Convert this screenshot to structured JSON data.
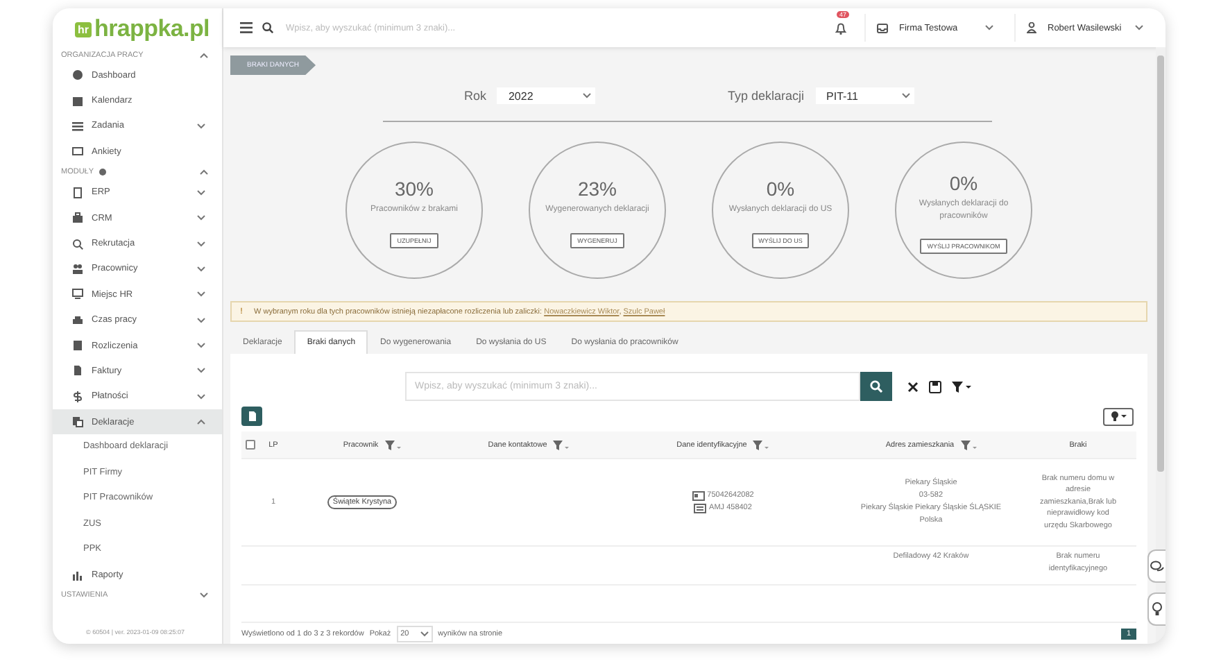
{
  "logo": {
    "badge": "hr",
    "text": "hrappka.pl"
  },
  "sidebar": {
    "sections": [
      {
        "title": "ORGANIZACJA PRACY",
        "expanded": true,
        "items": [
          {
            "label": "Dashboard",
            "selected": false
          },
          {
            "label": "Kalendarz",
            "selected": false
          },
          {
            "label": "Zadania",
            "expanded": false,
            "selected": false
          },
          {
            "label": "Ankiety",
            "selected": false
          }
        ]
      },
      {
        "title": "MODUŁY",
        "expanded": true,
        "items": [
          {
            "label": "ERP",
            "expanded": false,
            "selected": false
          },
          {
            "label": "CRM",
            "expanded": false,
            "selected": false
          },
          {
            "label": "Rekrutacja",
            "expanded": false,
            "selected": false
          },
          {
            "label": "Pracownicy",
            "expanded": false,
            "selected": false
          },
          {
            "label": "Miejsc HR",
            "expanded": false,
            "selected": false
          },
          {
            "label": "Czas pracy",
            "expanded": false,
            "selected": false
          },
          {
            "label": "Rozliczenia",
            "expanded": false,
            "selected": false
          },
          {
            "label": "Faktury",
            "expanded": false,
            "selected": false
          },
          {
            "label": "Płatności",
            "expanded": false,
            "selected": false
          },
          {
            "label": "Deklaracje",
            "expanded": true,
            "selected": true,
            "children": [
              {
                "label": "Dashboard deklaracji"
              },
              {
                "label": "PIT Firmy"
              },
              {
                "label": "PIT Pracowników"
              },
              {
                "label": "ZUS"
              },
              {
                "label": "PPK"
              }
            ]
          },
          {
            "label": "Raporty",
            "selected": false
          }
        ]
      },
      {
        "title": "USTAWIENIA",
        "expanded": false
      }
    ],
    "footer": "© 60504 | ver. 2023-01-09 08:25:07"
  },
  "topbar": {
    "search_placeholder": "Wpisz, aby wyszukać (minimum 3 znaki)...",
    "notifications": "47",
    "company": "Firma Testowa",
    "user": "Robert Wasilewski"
  },
  "breadcrumb": "BRAKI DANYCH",
  "filters": [
    {
      "label": "Rok",
      "value": "2022"
    },
    {
      "label": "Typ deklaracji",
      "value": "PIT-11"
    }
  ],
  "stats": [
    {
      "percent": "30%",
      "label": "Pracowników z brakami",
      "button": "UZUPEŁNIJ"
    },
    {
      "percent": "23%",
      "label": "Wygenerowanych deklaracji",
      "button": "WYGENERUJ"
    },
    {
      "percent": "0%",
      "label": "Wysłanych deklaracji do US",
      "button": "WYŚLIJ DO US"
    },
    {
      "percent": "0%",
      "label": "Wysłanych deklaracji do pracowników",
      "button": "WYŚLIJ PRACOWNIKOM"
    }
  ],
  "alert": {
    "icon": "!",
    "text": "W wybranym roku dla tych pracowników istnieją niezapłacone rozliczenia lub zaliczki:",
    "links": [
      "Nowaczkiewicz Wiktor",
      "Szulc Paweł"
    ],
    "separator": ","
  },
  "tabs": [
    {
      "label": "Deklaracje",
      "selected": false
    },
    {
      "label": "Braki danych",
      "selected": true
    },
    {
      "label": "Do wygenerowania",
      "selected": false
    },
    {
      "label": "Do wysłania do US",
      "selected": false
    },
    {
      "label": "Do wysłania do pracowników",
      "selected": false
    }
  ],
  "search": {
    "placeholder": "Wpisz, aby wyszukać (minimum 3 znaki)..."
  },
  "table": {
    "select_all": {
      "checked": false
    },
    "columns": [
      {
        "label": "LP",
        "filter": false
      },
      {
        "label": "Pracownik",
        "filter": true
      },
      {
        "label": "Dane kontaktowe",
        "filter": true
      },
      {
        "label": "Dane identyfikacyjne",
        "filter": true
      },
      {
        "label": "Adres zamieszkania",
        "filter": true
      },
      {
        "label": "Braki",
        "filter": false
      }
    ],
    "rows": [
      {
        "lp": "1",
        "employee": "Świątek Krystyna",
        "ids": [
          "75042642082",
          "AMJ 458402"
        ],
        "address": [
          "Piekary Śląskie",
          "03-582",
          "Piekary Śląskie Piekary Śląskie ŚLĄSKIE",
          "Polska"
        ],
        "missing": "Brak numeru domu w adresie zamieszkania,Brak lub nieprawidłowy kod urzędu Skarbowego"
      },
      {
        "address": [
          "Defiladowy 42 Kraków"
        ],
        "missing": "Brak numeru identyfikacyjnego"
      }
    ]
  },
  "pager": {
    "summary": "Wyświetlono od 1 do 3 z 3 rekordów",
    "show": "Pokaż",
    "per_page": "20",
    "suffix": "wyników na stronie",
    "page": "1"
  }
}
